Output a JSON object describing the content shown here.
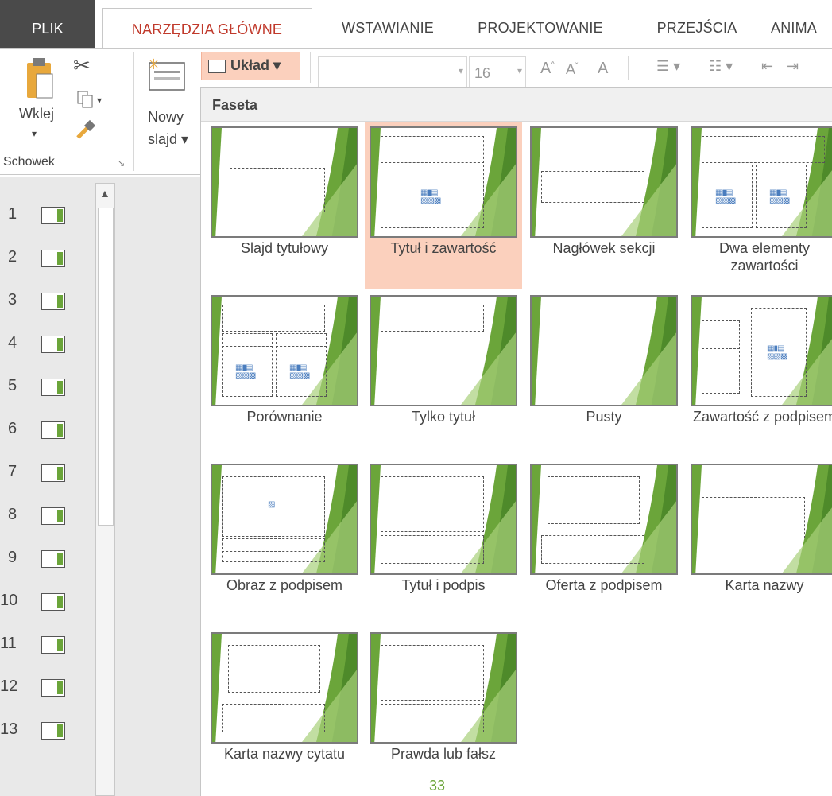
{
  "tabs": [
    {
      "label": "PLIK"
    },
    {
      "label": "NARZĘDZIA GŁÓWNE"
    },
    {
      "label": "WSTAWIANIE"
    },
    {
      "label": "PROJEKTOWANIE"
    },
    {
      "label": "PRZEJŚCIA"
    },
    {
      "label": "ANIMA"
    }
  ],
  "ribbon": {
    "paste_label": "Wklej",
    "clipboard_group": "Schowek",
    "new_slide_line1": "Nowy",
    "new_slide_line2": "slajd ▾",
    "layout_button": "Układ ▾",
    "font_size": "16"
  },
  "dropdown": {
    "header": "Faseta",
    "layouts": [
      {
        "label": "Slajd tytułowy"
      },
      {
        "label": "Tytuł i zawartość"
      },
      {
        "label": "Nagłówek sekcji"
      },
      {
        "label": "Dwa elementy zawartości"
      },
      {
        "label": "Porównanie"
      },
      {
        "label": "Tylko tytuł"
      },
      {
        "label": "Pusty"
      },
      {
        "label": "Zawartość z podpisem"
      },
      {
        "label": "Obraz z podpisem"
      },
      {
        "label": "Tytuł i podpis"
      },
      {
        "label": "Oferta z podpisem"
      },
      {
        "label": "Karta nazwy"
      },
      {
        "label": "Karta nazwy cytatu"
      },
      {
        "label": "Prawda lub fałsz"
      }
    ],
    "selected_index": 1
  },
  "slides": [
    "1",
    "2",
    "3",
    "4",
    "5",
    "6",
    "7",
    "8",
    "9",
    "10",
    "11",
    "12",
    "13"
  ],
  "page_number": "33",
  "colors": {
    "accent": "#c0392b",
    "green": "#6ba53a",
    "selected": "#fbd0bd"
  }
}
